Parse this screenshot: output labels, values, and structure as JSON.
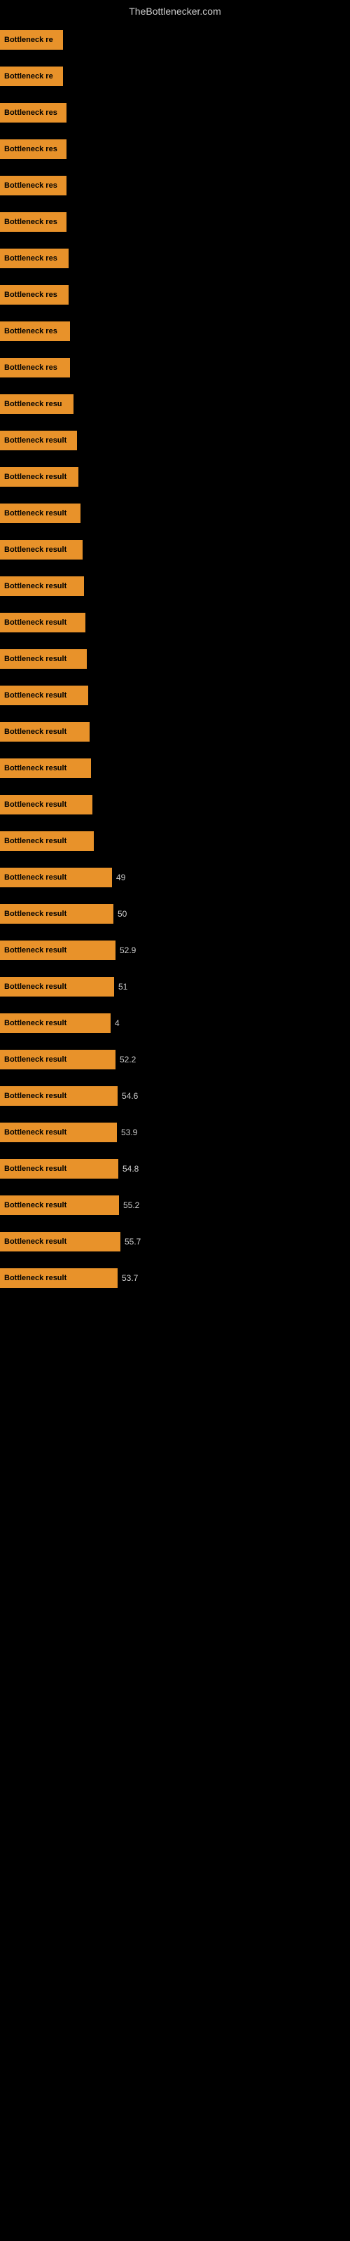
{
  "header": {
    "title": "TheBottlenecker.com"
  },
  "bars": [
    {
      "label": "Bottleneck re",
      "width": 90,
      "value": "",
      "gap": true
    },
    {
      "label": "Bottleneck re",
      "width": 90,
      "value": "",
      "gap": true
    },
    {
      "label": "Bottleneck res",
      "width": 95,
      "value": "",
      "gap": true
    },
    {
      "label": "Bottleneck res",
      "width": 95,
      "value": "",
      "gap": true
    },
    {
      "label": "Bottleneck res",
      "width": 95,
      "value": "",
      "gap": true
    },
    {
      "label": "Bottleneck res",
      "width": 95,
      "value": "",
      "gap": true
    },
    {
      "label": "Bottleneck res",
      "width": 98,
      "value": "",
      "gap": true
    },
    {
      "label": "Bottleneck res",
      "width": 98,
      "value": "",
      "gap": true
    },
    {
      "label": "Bottleneck res",
      "width": 100,
      "value": "",
      "gap": true
    },
    {
      "label": "Bottleneck res",
      "width": 100,
      "value": "",
      "gap": true
    },
    {
      "label": "Bottleneck resu",
      "width": 105,
      "value": "",
      "gap": true
    },
    {
      "label": "Bottleneck result",
      "width": 110,
      "value": "",
      "gap": true
    },
    {
      "label": "Bottleneck result",
      "width": 112,
      "value": "",
      "gap": true
    },
    {
      "label": "Bottleneck result",
      "width": 115,
      "value": "",
      "gap": true
    },
    {
      "label": "Bottleneck result",
      "width": 118,
      "value": "",
      "gap": true
    },
    {
      "label": "Bottleneck result",
      "width": 120,
      "value": "",
      "gap": true
    },
    {
      "label": "Bottleneck result",
      "width": 122,
      "value": "",
      "gap": true
    },
    {
      "label": "Bottleneck result",
      "width": 124,
      "value": "",
      "gap": true
    },
    {
      "label": "Bottleneck result",
      "width": 126,
      "value": "",
      "gap": true
    },
    {
      "label": "Bottleneck result",
      "width": 128,
      "value": "",
      "gap": true
    },
    {
      "label": "Bottleneck result",
      "width": 130,
      "value": "",
      "gap": true
    },
    {
      "label": "Bottleneck result",
      "width": 132,
      "value": "",
      "gap": true
    },
    {
      "label": "Bottleneck result",
      "width": 134,
      "value": "",
      "gap": true
    },
    {
      "label": "Bottleneck result",
      "width": 160,
      "value": "49",
      "gap": true
    },
    {
      "label": "Bottleneck result",
      "width": 162,
      "value": "50",
      "gap": true
    },
    {
      "label": "Bottleneck result",
      "width": 165,
      "value": "52.9",
      "gap": true
    },
    {
      "label": "Bottleneck result",
      "width": 163,
      "value": "51",
      "gap": true
    },
    {
      "label": "Bottleneck result",
      "width": 158,
      "value": "4",
      "gap": true
    },
    {
      "label": "Bottleneck result",
      "width": 165,
      "value": "52.2",
      "gap": true
    },
    {
      "label": "Bottleneck result",
      "width": 168,
      "value": "54.6",
      "gap": true
    },
    {
      "label": "Bottleneck result",
      "width": 167,
      "value": "53.9",
      "gap": true
    },
    {
      "label": "Bottleneck result",
      "width": 169,
      "value": "54.8",
      "gap": true
    },
    {
      "label": "Bottleneck result",
      "width": 170,
      "value": "55.2",
      "gap": true
    },
    {
      "label": "Bottleneck result",
      "width": 172,
      "value": "55.7",
      "gap": true
    },
    {
      "label": "Bottleneck result",
      "width": 168,
      "value": "53.7",
      "gap": false
    }
  ]
}
